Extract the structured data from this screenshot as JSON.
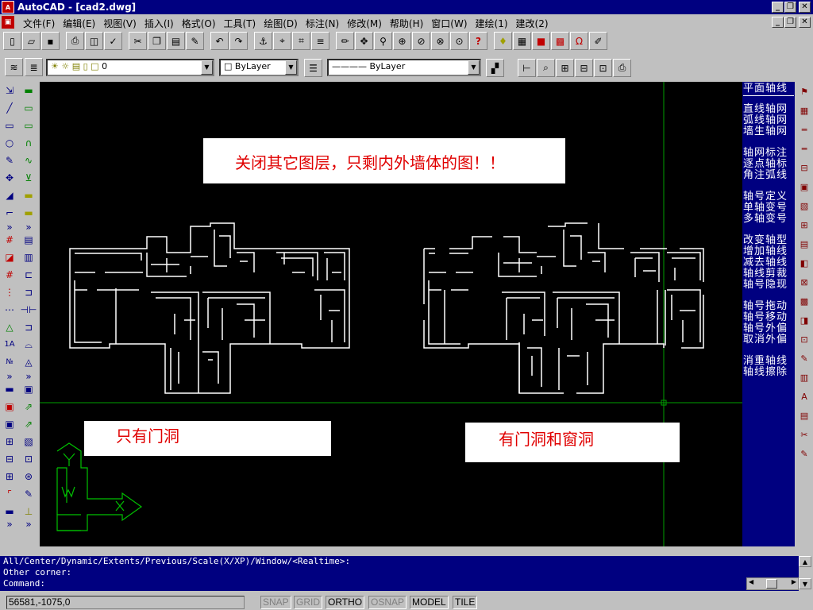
{
  "window": {
    "title": "AutoCAD - [cad2.dwg]",
    "app_icon": "autocad-icon",
    "min": "_",
    "max": "❐",
    "close": "✕"
  },
  "menu": {
    "items": [
      "文件(F)",
      "编辑(E)",
      "视图(V)",
      "插入(I)",
      "格式(O)",
      "工具(T)",
      "绘图(D)",
      "标注(N)",
      "修改(M)",
      "帮助(H)",
      "窗口(W)",
      "建绘(1)",
      "建改(2)"
    ]
  },
  "layer_toolbar": {
    "layer_value": "0",
    "color_value": "ByLayer",
    "linetype_value": "———— ByLayer"
  },
  "canvas": {
    "annotation_top": "关闭其它图层，只剩内外墙体的图！！",
    "annotation_left": "只有门洞",
    "annotation_right": "有门洞和窗洞",
    "ucs_y": "Y",
    "ucs_x": "X",
    "ucs_w": "W",
    "colors": {
      "background": "#000000",
      "wall": "#ffffff",
      "crosshair": "#00a000",
      "annotation_text": "#e00000"
    }
  },
  "right_menu": {
    "header": "平面轴线",
    "groups": [
      [
        "直线轴网",
        "弧线轴网",
        "墙生轴网"
      ],
      [
        "轴网标注",
        "逐点轴标",
        "角注弧线"
      ],
      [
        "轴号定义",
        "单轴变号",
        "多轴变号"
      ],
      [
        "改变轴型",
        "增加轴线",
        "减去轴线",
        "轴线剪裁",
        "轴号隐现"
      ],
      [
        "轴号拖动",
        "轴号移动",
        "轴号外偏",
        "取消外偏"
      ],
      [
        "消重轴线",
        "轴线擦除"
      ]
    ]
  },
  "command": {
    "lines": [
      "All/Center/Dynamic/Extents/Previous/Scale(X/XP)/Window/<Realtime>:",
      "Other corner:",
      "Command:"
    ]
  },
  "status": {
    "coords": "56581,-1075,0",
    "buttons": [
      {
        "label": "SNAP",
        "on": false
      },
      {
        "label": "GRID",
        "on": false
      },
      {
        "label": "ORTHO",
        "on": true
      },
      {
        "label": "OSNAP",
        "on": false
      },
      {
        "label": "MODEL",
        "on": true
      },
      {
        "label": "TILE",
        "on": true
      }
    ]
  }
}
